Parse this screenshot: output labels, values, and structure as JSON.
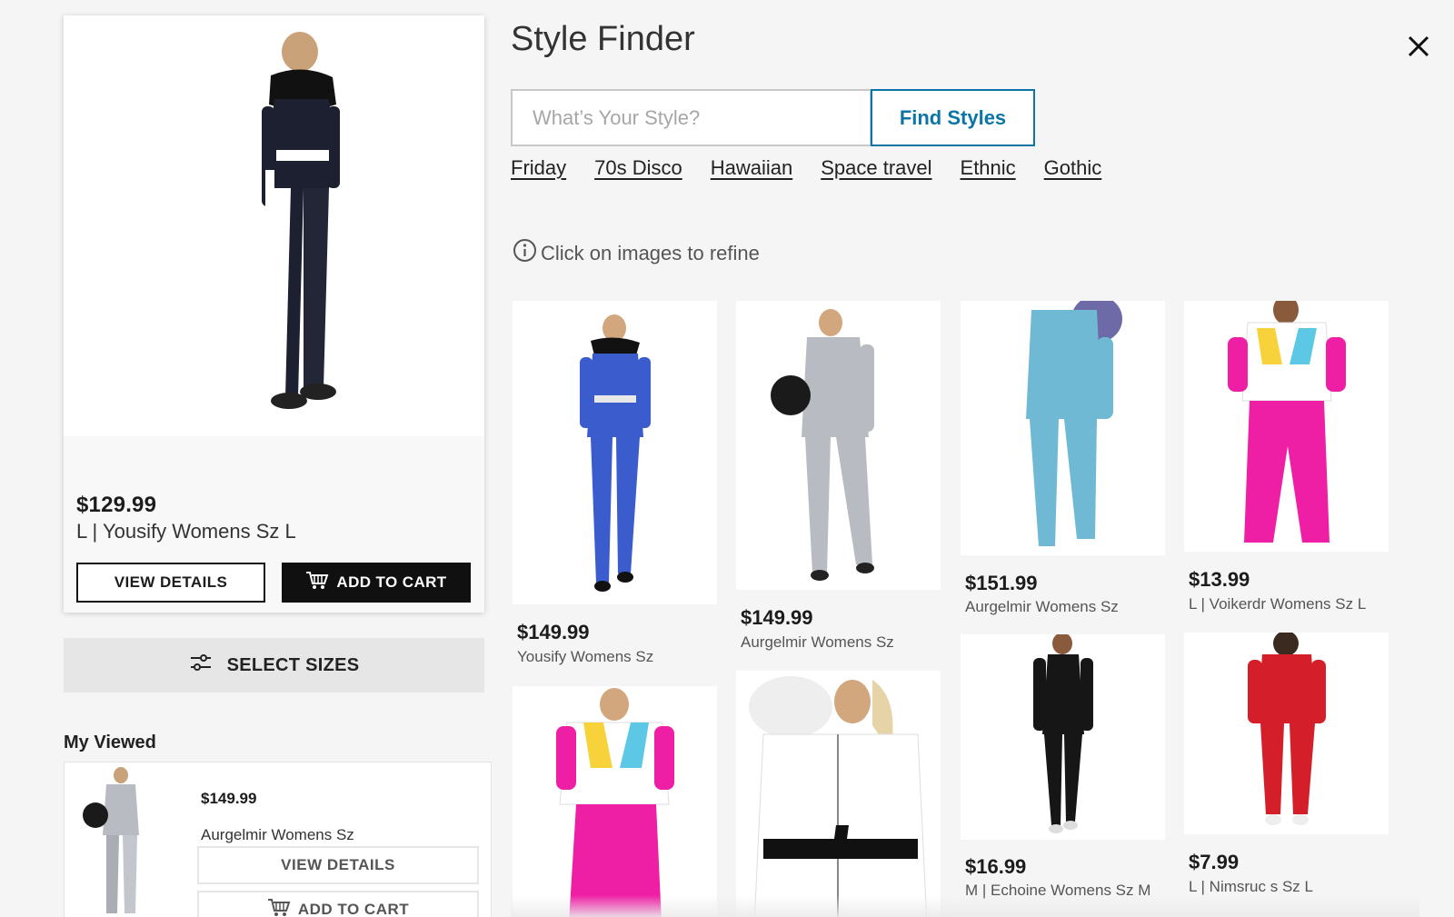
{
  "featured": {
    "price": "$129.99",
    "title": "L | Yousify Womens Sz L",
    "view_details": "VIEW DETAILS",
    "add_to_cart": "ADD TO CART"
  },
  "select_sizes": "SELECT SIZES",
  "my_viewed": {
    "heading": "My Viewed",
    "item": {
      "price": "$149.99",
      "title": "Aurgelmir Womens Sz",
      "view_details": "VIEW DETAILS",
      "add_to_cart": "ADD TO CART"
    }
  },
  "header": {
    "title": "Style Finder",
    "close_icon": "close-icon"
  },
  "search": {
    "placeholder": "What’s Your Style?",
    "value": "",
    "button": "Find Styles"
  },
  "style_chips": [
    "Friday",
    "70s Disco",
    "Hawaiian",
    "Space travel",
    "Ethnic",
    "Gothic"
  ],
  "hint": "Click on images to refine",
  "products": [
    {
      "price": "$149.99",
      "title": "Yousify Womens Sz",
      "color": "#3a5ccc"
    },
    {
      "price": "$149.99",
      "title": "Aurgelmir Womens Sz",
      "color": "#b8bcc2"
    },
    {
      "price": "$151.99",
      "title": "Aurgelmir Womens Sz",
      "color": "#6fb9d4"
    },
    {
      "price": "$13.99",
      "title": "L | Voikerdr Womens Sz L",
      "color": "#ee1fa5"
    },
    {
      "price": "",
      "title": "",
      "color": "#ee1fa5"
    },
    {
      "price": "",
      "title": "",
      "color": "#ffffff"
    },
    {
      "price": "$16.99",
      "title": "M | Echoine Womens Sz M",
      "color": "#161616"
    },
    {
      "price": "$7.99",
      "title": "L | Nimsruc s Sz L",
      "color": "#d41f2a"
    }
  ],
  "colors": {
    "accent": "#0b75a6",
    "dark_button": "#101010"
  }
}
